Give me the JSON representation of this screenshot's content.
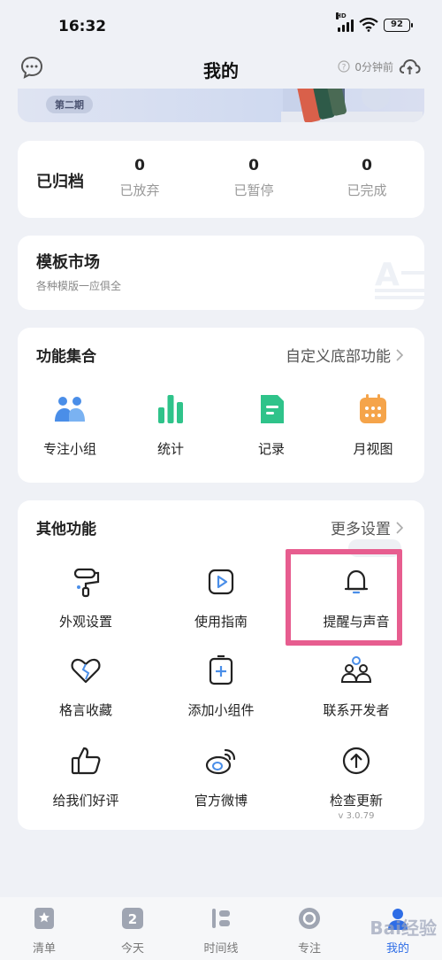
{
  "status": {
    "time": "16:32",
    "hd": "HD",
    "battery": "92"
  },
  "nav": {
    "title": "我的",
    "last_sync": "0分钟前"
  },
  "banner": {
    "tag": "第二期"
  },
  "archive": {
    "title": "已归档",
    "stats": [
      {
        "value": "0",
        "label": "已放弃"
      },
      {
        "value": "0",
        "label": "已暂停"
      },
      {
        "value": "0",
        "label": "已完成"
      }
    ]
  },
  "template_market": {
    "title": "模板市场",
    "subtitle": "各种模版一应俱全"
  },
  "features": {
    "title": "功能集合",
    "link": "自定义底部功能",
    "items": [
      {
        "label": "专注小组",
        "icon": "group-icon"
      },
      {
        "label": "统计",
        "icon": "bar-chart-icon"
      },
      {
        "label": "记录",
        "icon": "note-icon"
      },
      {
        "label": "月视图",
        "icon": "calendar-icon"
      }
    ]
  },
  "other": {
    "title": "其他功能",
    "link": "更多设置",
    "items": [
      {
        "label": "外观设置",
        "icon": "paint-roller-icon"
      },
      {
        "label": "使用指南",
        "icon": "play-guide-icon"
      },
      {
        "label": "提醒与声音",
        "icon": "bell-icon"
      },
      {
        "label": "格言收藏",
        "icon": "heart-icon"
      },
      {
        "label": "添加小组件",
        "icon": "add-widget-icon"
      },
      {
        "label": "联系开发者",
        "icon": "people-icon"
      },
      {
        "label": "给我们好评",
        "icon": "thumbs-up-icon"
      },
      {
        "label": "官方微博",
        "icon": "weibo-icon"
      },
      {
        "label": "检查更新",
        "icon": "upgrade-icon"
      }
    ],
    "version": "v 3.0.79"
  },
  "tabbar": {
    "items": [
      {
        "label": "清单",
        "icon": "list-icon"
      },
      {
        "label": "今天",
        "icon": "today-icon",
        "badge": "2"
      },
      {
        "label": "时间线",
        "icon": "timeline-icon"
      },
      {
        "label": "专注",
        "icon": "focus-icon"
      },
      {
        "label": "我的",
        "icon": "profile-icon",
        "active": true
      }
    ]
  },
  "watermark": "Bai经验",
  "colors": {
    "accent": "#2e6de6",
    "highlight": "#e75d8f",
    "green": "#2fc38a",
    "orange": "#f5a44a",
    "blue": "#4a8ee8"
  }
}
